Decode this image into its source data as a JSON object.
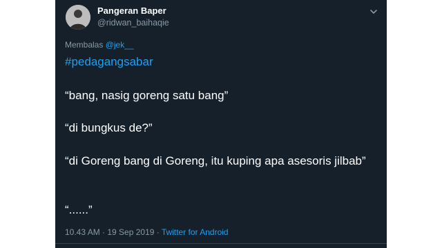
{
  "tweet": {
    "display_name": "Pangeran Baper",
    "username": "@ridwan_baihaqie",
    "reply_prefix": "Membalas ",
    "reply_mention": "@jek__",
    "hashtag": "#pedagangsabar",
    "lines": [
      "“bang, nasig goreng satu bang”",
      "“di bungkus de?”",
      "“di Goreng bang di Goreng, itu kuping apa asesoris jilbab”",
      "“......”"
    ],
    "timestamp": "10.43 AM · 19 Sep 2019 · ",
    "source": "Twitter for Android"
  },
  "colors": {
    "background": "#15202b",
    "link": "#1da1f2",
    "secondary_text": "#8899a6"
  },
  "icons": {
    "chevron": "chevron-down-icon",
    "avatar": "avatar"
  }
}
